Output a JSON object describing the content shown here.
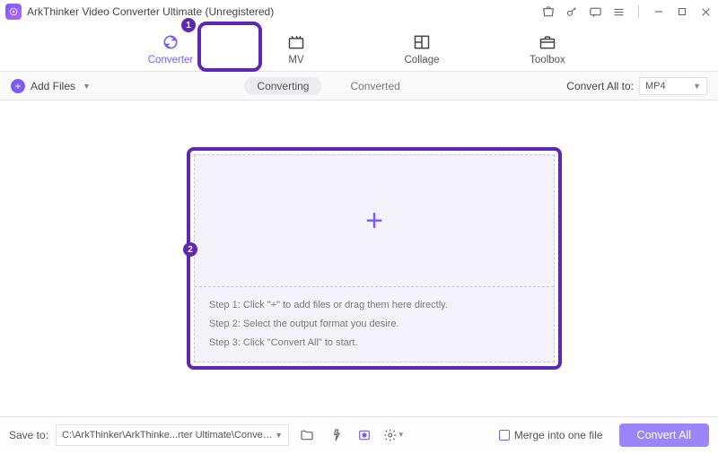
{
  "app": {
    "title": "ArkThinker Video Converter Ultimate (Unregistered)"
  },
  "tabs": {
    "converter": "Converter",
    "mv": "MV",
    "collage": "Collage",
    "toolbox": "Toolbox"
  },
  "annotations": {
    "step1": "1",
    "step2": "2"
  },
  "toolbar": {
    "addFiles": "Add Files",
    "seg_converting": "Converting",
    "seg_converted": "Converted",
    "convertAllTo": "Convert All to:",
    "format": "MP4"
  },
  "drop": {
    "step1": "Step 1: Click \"+\" to add files or drag them here directly.",
    "step2": "Step 2: Select the output format you desire.",
    "step3": "Step 3: Click \"Convert All\" to start."
  },
  "bottom": {
    "saveTo": "Save to:",
    "path": "C:\\ArkThinker\\ArkThinke...rter Ultimate\\Converted",
    "merge": "Merge into one file",
    "convertAll": "Convert All"
  }
}
